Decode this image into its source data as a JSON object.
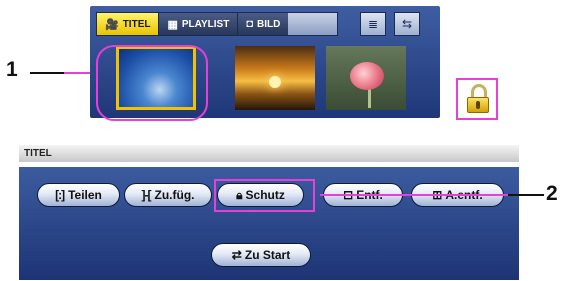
{
  "browser": {
    "tabs": [
      {
        "label": "TITEL",
        "icon": "camcorder-icon",
        "glyph": "🎥",
        "active": true
      },
      {
        "label": "PLAYLIST",
        "icon": "playlist-icon",
        "glyph": "▦",
        "active": false
      },
      {
        "label": "BILD",
        "icon": "camera-icon",
        "glyph": "◘",
        "active": false
      }
    ],
    "toolbar": [
      {
        "icon": "menu-list-icon",
        "glyph": "≣"
      },
      {
        "icon": "switch-view-icon",
        "glyph": "⇆"
      }
    ],
    "thumbnails": [
      "blue-sky-scene",
      "sunset-scene",
      "flower-scene"
    ],
    "protected_icon": "lock-icon"
  },
  "callouts": {
    "one": "1",
    "two": "2"
  },
  "menu": {
    "title": "TITEL",
    "buttons": {
      "teilen": {
        "glyph": "[:]",
        "label": "Teilen"
      },
      "zufueg": {
        "glyph": "]-[",
        "label": "Zu.füg."
      },
      "schutz": {
        "glyph": "🔒︎",
        "label": "Schutz"
      },
      "entf": {
        "glyph": "⊟",
        "label": "Entf."
      },
      "aentf": {
        "glyph": "⊞",
        "label": "A.entf."
      },
      "start": {
        "glyph": "⇄",
        "label": "Zu Start"
      }
    }
  },
  "colors": {
    "highlight": "#e640d8",
    "panel": "#2a4690",
    "active_tab": "#f2d21a"
  }
}
